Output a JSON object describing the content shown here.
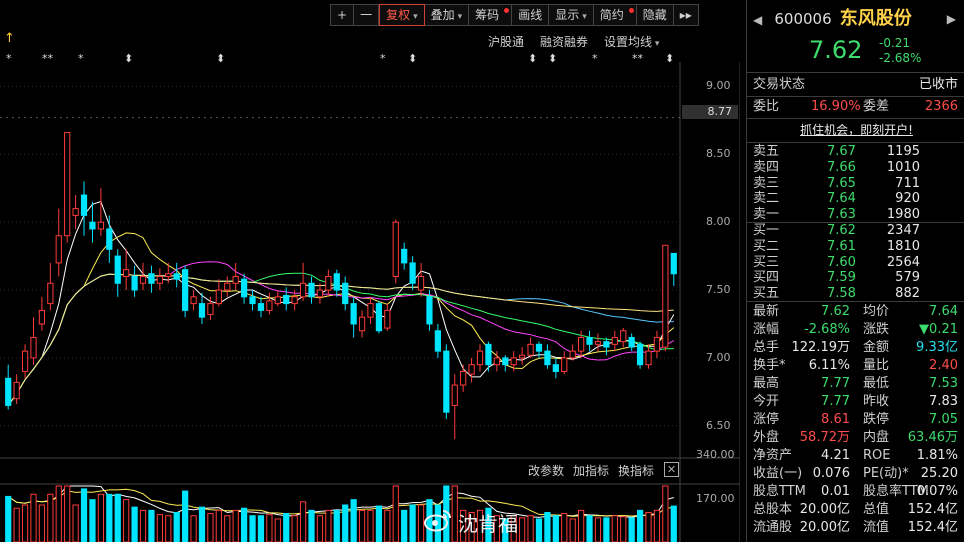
{
  "toolbar": {
    "plus": "+",
    "minus": "一",
    "items": [
      {
        "label": "复权",
        "caret": true,
        "dot": false,
        "active": true
      },
      {
        "label": "叠加",
        "caret": true,
        "dot": false,
        "active": false
      },
      {
        "label": "筹码",
        "caret": false,
        "dot": true,
        "active": false
      },
      {
        "label": "画线",
        "caret": false,
        "dot": false,
        "active": false
      },
      {
        "label": "显示",
        "caret": true,
        "dot": false,
        "active": false
      },
      {
        "label": "简约",
        "caret": false,
        "dot": true,
        "active": false
      },
      {
        "label": "隐藏",
        "caret": false,
        "dot": false,
        "active": false
      }
    ],
    "more": "▸▸"
  },
  "subbar": {
    "hgt": "沪股通",
    "margin": "融资融券",
    "ma": "设置均线"
  },
  "chart_data": {
    "type": "candlestick",
    "ylim": [
      6.27,
      9.18
    ],
    "y_ticks": [
      "9.00",
      "8.50",
      "8.00",
      "7.50",
      "7.00",
      "6.50"
    ],
    "y_tick_values": [
      9.0,
      8.5,
      8.0,
      7.5,
      7.0,
      6.5
    ],
    "last_price_label": "8.77",
    "last_price_value": 8.77,
    "candles": [
      [
        6.85,
        6.65,
        6.95,
        6.62
      ],
      [
        6.7,
        6.82,
        6.88,
        6.66
      ],
      [
        6.9,
        7.05,
        7.1,
        6.85
      ],
      [
        7.0,
        7.15,
        7.3,
        6.95
      ],
      [
        7.25,
        7.35,
        7.45,
        7.2
      ],
      [
        7.4,
        7.55,
        7.7,
        7.35
      ],
      [
        7.7,
        7.9,
        8.1,
        7.6
      ],
      [
        7.9,
        8.66,
        8.66,
        7.85
      ],
      [
        8.05,
        8.1,
        8.2,
        7.95
      ],
      [
        8.2,
        8.05,
        8.3,
        7.9
      ],
      [
        8.0,
        7.95,
        8.15,
        7.85
      ],
      [
        7.95,
        8.0,
        8.25,
        7.9
      ],
      [
        7.95,
        7.8,
        8.05,
        7.7
      ],
      [
        7.75,
        7.55,
        7.8,
        7.45
      ],
      [
        7.6,
        7.65,
        7.8,
        7.5
      ],
      [
        7.6,
        7.5,
        7.68,
        7.45
      ],
      [
        7.55,
        7.6,
        7.7,
        7.5
      ],
      [
        7.62,
        7.55,
        7.68,
        7.48
      ],
      [
        7.55,
        7.6,
        7.66,
        7.5
      ],
      [
        7.6,
        7.62,
        7.7,
        7.55
      ],
      [
        7.62,
        7.58,
        7.7,
        7.52
      ],
      [
        7.65,
        7.35,
        7.68,
        7.3
      ],
      [
        7.4,
        7.45,
        7.5,
        7.35
      ],
      [
        7.4,
        7.3,
        7.48,
        7.25
      ],
      [
        7.32,
        7.4,
        7.45,
        7.28
      ],
      [
        7.4,
        7.5,
        7.58,
        7.38
      ],
      [
        7.5,
        7.55,
        7.6,
        7.45
      ],
      [
        7.55,
        7.6,
        7.7,
        7.5
      ],
      [
        7.58,
        7.45,
        7.62,
        7.4
      ],
      [
        7.45,
        7.4,
        7.5,
        7.35
      ],
      [
        7.4,
        7.35,
        7.45,
        7.3
      ],
      [
        7.35,
        7.42,
        7.48,
        7.32
      ],
      [
        7.4,
        7.45,
        7.5,
        7.38
      ],
      [
        7.46,
        7.4,
        7.52,
        7.35
      ],
      [
        7.4,
        7.45,
        7.5,
        7.35
      ],
      [
        7.45,
        7.55,
        7.7,
        7.42
      ],
      [
        7.55,
        7.45,
        7.6,
        7.4
      ],
      [
        7.45,
        7.5,
        7.55,
        7.4
      ],
      [
        7.5,
        7.6,
        7.65,
        7.45
      ],
      [
        7.62,
        7.5,
        7.65,
        7.45
      ],
      [
        7.55,
        7.4,
        7.6,
        7.35
      ],
      [
        7.4,
        7.25,
        7.45,
        7.15
      ],
      [
        7.2,
        7.3,
        7.35,
        7.15
      ],
      [
        7.3,
        7.4,
        7.45,
        7.25
      ],
      [
        7.4,
        7.2,
        7.42,
        7.18
      ],
      [
        7.22,
        7.35,
        7.4,
        7.2
      ],
      [
        7.6,
        8.0,
        8.02,
        7.55
      ],
      [
        7.8,
        7.7,
        7.85,
        7.65
      ],
      [
        7.7,
        7.55,
        7.75,
        7.5
      ],
      [
        7.5,
        7.6,
        7.7,
        7.45
      ],
      [
        7.45,
        7.25,
        7.5,
        7.2
      ],
      [
        7.2,
        7.05,
        7.25,
        7.0
      ],
      [
        7.05,
        6.6,
        7.1,
        6.55
      ],
      [
        6.65,
        6.8,
        6.88,
        6.4
      ],
      [
        6.8,
        6.9,
        6.95,
        6.75
      ],
      [
        6.88,
        6.95,
        7.0,
        6.82
      ],
      [
        6.95,
        7.05,
        7.1,
        6.9
      ],
      [
        7.1,
        6.95,
        7.12,
        6.9
      ],
      [
        6.95,
        7.0,
        7.05,
        6.9
      ],
      [
        7.0,
        6.95,
        7.02,
        6.9
      ],
      [
        6.95,
        7.0,
        7.05,
        6.9
      ],
      [
        7.0,
        7.02,
        7.08,
        6.95
      ],
      [
        7.02,
        7.1,
        7.15,
        7.0
      ],
      [
        7.1,
        7.05,
        7.12,
        7.0
      ],
      [
        7.05,
        6.95,
        7.1,
        6.92
      ],
      [
        6.95,
        6.9,
        7.0,
        6.85
      ],
      [
        6.9,
        7.0,
        7.05,
        6.88
      ],
      [
        7.0,
        7.05,
        7.1,
        6.98
      ],
      [
        7.05,
        7.15,
        7.2,
        7.0
      ],
      [
        7.15,
        7.1,
        7.2,
        7.05
      ],
      [
        7.1,
        7.12,
        7.18,
        7.05
      ],
      [
        7.12,
        7.08,
        7.15,
        7.02
      ],
      [
        7.1,
        7.15,
        7.2,
        7.05
      ],
      [
        7.12,
        7.2,
        7.22,
        7.08
      ],
      [
        7.15,
        7.08,
        7.18,
        7.05
      ],
      [
        7.1,
        6.95,
        7.12,
        6.92
      ],
      [
        6.95,
        7.05,
        7.1,
        6.92
      ],
      [
        7.05,
        7.15,
        7.2,
        7.0
      ],
      [
        7.08,
        7.83,
        7.83,
        7.05
      ],
      [
        7.77,
        7.62,
        7.77,
        7.53
      ]
    ],
    "volume_ylim": [
      0,
      500
    ],
    "volume_ticks": [
      "340.00",
      "170.00"
    ],
    "volume_tick_values": [
      340,
      170
    ]
  },
  "star_marks": [
    "*",
    "**",
    "*",
    "⬍",
    "⬍",
    "*",
    "⬍",
    "⬍",
    "⬍",
    "*",
    "**",
    "⬍"
  ],
  "indicator_bar": {
    "params": "改参数",
    "add": "加指标",
    "switch": "换指标",
    "close": "✕"
  },
  "watermark": "沈肯福",
  "stock": {
    "code": "600006",
    "name": "东风股份",
    "price": "7.62",
    "change": "-0.21",
    "pct": "-2.68%"
  },
  "status": {
    "label": "交易状态",
    "value": "已收市"
  },
  "weibi": {
    "label": "委比",
    "value": "16.90%",
    "diff_label": "委差",
    "diff_value": "2366"
  },
  "promo": "抓住机会，即刻开户!",
  "asks": [
    {
      "label": "卖五",
      "price": "7.67",
      "vol": "1195"
    },
    {
      "label": "卖四",
      "price": "7.66",
      "vol": "1010"
    },
    {
      "label": "卖三",
      "price": "7.65",
      "vol": "711"
    },
    {
      "label": "卖二",
      "price": "7.64",
      "vol": "920"
    },
    {
      "label": "卖一",
      "price": "7.63",
      "vol": "1980"
    }
  ],
  "bids": [
    {
      "label": "买一",
      "price": "7.62",
      "vol": "2347"
    },
    {
      "label": "买二",
      "price": "7.61",
      "vol": "1810"
    },
    {
      "label": "买三",
      "price": "7.60",
      "vol": "2564"
    },
    {
      "label": "买四",
      "price": "7.59",
      "vol": "579"
    },
    {
      "label": "买五",
      "price": "7.58",
      "vol": "882"
    }
  ],
  "stats": [
    {
      "l1": "最新",
      "v1": "7.62",
      "c1": "g",
      "l2": "均价",
      "v2": "7.64",
      "c2": "g"
    },
    {
      "l1": "涨幅",
      "v1": "-2.68%",
      "c1": "g",
      "l2": "涨跌",
      "v2": "▼0.21",
      "c2": "g"
    },
    {
      "l1": "总手",
      "v1": "122.19万",
      "c1": "w",
      "l2": "金额",
      "v2": "9.33亿",
      "c2": "cy"
    },
    {
      "l1": "换手*",
      "v1": "6.11%",
      "c1": "w",
      "l2": "量比",
      "v2": "2.40",
      "c2": "r"
    },
    {
      "l1": "最高",
      "v1": "7.77",
      "c1": "g",
      "l2": "最低",
      "v2": "7.53",
      "c2": "g"
    },
    {
      "l1": "今开",
      "v1": "7.77",
      "c1": "g",
      "l2": "昨收",
      "v2": "7.83",
      "c2": "w"
    },
    {
      "l1": "涨停",
      "v1": "8.61",
      "c1": "r",
      "l2": "跌停",
      "v2": "7.05",
      "c2": "g"
    },
    {
      "l1": "外盘",
      "v1": "58.72万",
      "c1": "r",
      "l2": "内盘",
      "v2": "63.46万",
      "c2": "g"
    },
    {
      "l1": "净资产",
      "v1": "4.21",
      "c1": "w",
      "l2": "ROE",
      "v2": "1.81%",
      "c2": "w"
    },
    {
      "l1": "收益(一)",
      "v1": "0.076",
      "c1": "w",
      "l2": "PE(动)*",
      "v2": "25.20",
      "c2": "w"
    },
    {
      "l1": "股息TTM",
      "v1": "0.01",
      "c1": "w",
      "l2": "股息率TTM",
      "v2": "0.07%",
      "c2": "w"
    },
    {
      "l1": "总股本",
      "v1": "20.00亿",
      "c1": "w",
      "l2": "总值",
      "v2": "152.4亿",
      "c2": "w"
    },
    {
      "l1": "流通股",
      "v1": "20.00亿",
      "c1": "w",
      "l2": "流值",
      "v2": "152.4亿",
      "c2": "w"
    }
  ],
  "colors": {
    "up": "#ff3b3b",
    "down": "#00e5ff",
    "ma5": "#ffffff",
    "ma10": "#ffee55",
    "ma20": "#ff44ff",
    "ma30": "#33ff66",
    "ma60": "#55c8ff",
    "ma120": "#ffe680"
  }
}
